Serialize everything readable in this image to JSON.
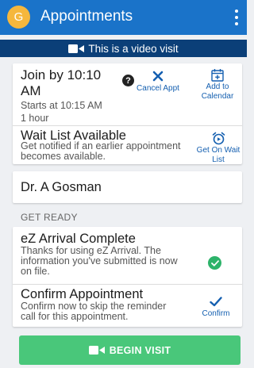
{
  "appbar": {
    "avatar_letter": "G",
    "title": "Appointments",
    "menu_icon": "more-vertical-icon"
  },
  "banner": {
    "icon": "video-camera-icon",
    "text": "This is a video visit"
  },
  "appointment": {
    "join_title": "Join by 10:10 AM",
    "starts": "Starts at 10:15 AM",
    "duration": "1 hour",
    "cancel_label": "Cancel Appt",
    "add_calendar_label": "Add to Calendar"
  },
  "waitlist": {
    "title": "Wait List Available",
    "subtitle": "Get notified if an earlier appointment becomes available.",
    "button_label": "Get On Wait List"
  },
  "provider": {
    "name": "Dr. A Gosman"
  },
  "get_ready": {
    "section_label": "GET READY",
    "arrival": {
      "title": "eZ Arrival Complete",
      "subtitle": "Thanks for using eZ Arrival. The information you've submitted is now on file."
    },
    "confirm": {
      "title": "Confirm Appointment",
      "subtitle": "Confirm now to skip the reminder call for this appointment.",
      "button_label": "Confirm"
    }
  },
  "begin_visit": {
    "label": "BEGIN VISIT"
  },
  "colors": {
    "appbar": "#1a73c9",
    "banner": "#0b3f78",
    "link": "#145fb0",
    "success": "#2db36a",
    "begin_button": "#49c77a",
    "avatar": "#f5b73d"
  }
}
